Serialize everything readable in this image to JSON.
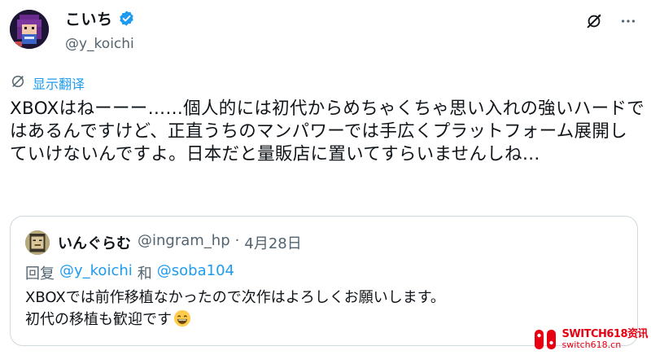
{
  "author": {
    "display_name": "こいち",
    "handle": "@y_koichi"
  },
  "translate": {
    "label": "显示翻译"
  },
  "tweet": {
    "text": "XBOXはねーーー……個人的には初代からめちゃくちゃ思い入れの強いハードではあるんですけど、正直うちのマンパワーでは手広くプラットフォーム展開していけないんですよ。日本だと量販店に置いてすらいませんしね…"
  },
  "quote": {
    "display_name": "いんぐらむ",
    "handle": "@ingram_hp",
    "separator": "·",
    "date": "4月28日",
    "reply_prefix": "回复",
    "reply_user1": "@y_koichi",
    "reply_and": "和",
    "reply_user2": "@soba104",
    "line1": "XBOXでは前作移植なかったので次作はよろしくお願いします。",
    "line2": "初代の移植も歓迎です"
  },
  "icons": {
    "verified": "verified-badge-icon",
    "grok": "grok-icon",
    "more": "more-icon",
    "translate": "translate-icon",
    "emoji": "grinning-face-emoji"
  },
  "watermark": {
    "title": "SWITCH618资讯",
    "url": "switch618.cn"
  },
  "colors": {
    "accent": "#1d9bf0",
    "secondary_text": "#536471",
    "border": "#cfd9de",
    "watermark": "#e60012"
  }
}
